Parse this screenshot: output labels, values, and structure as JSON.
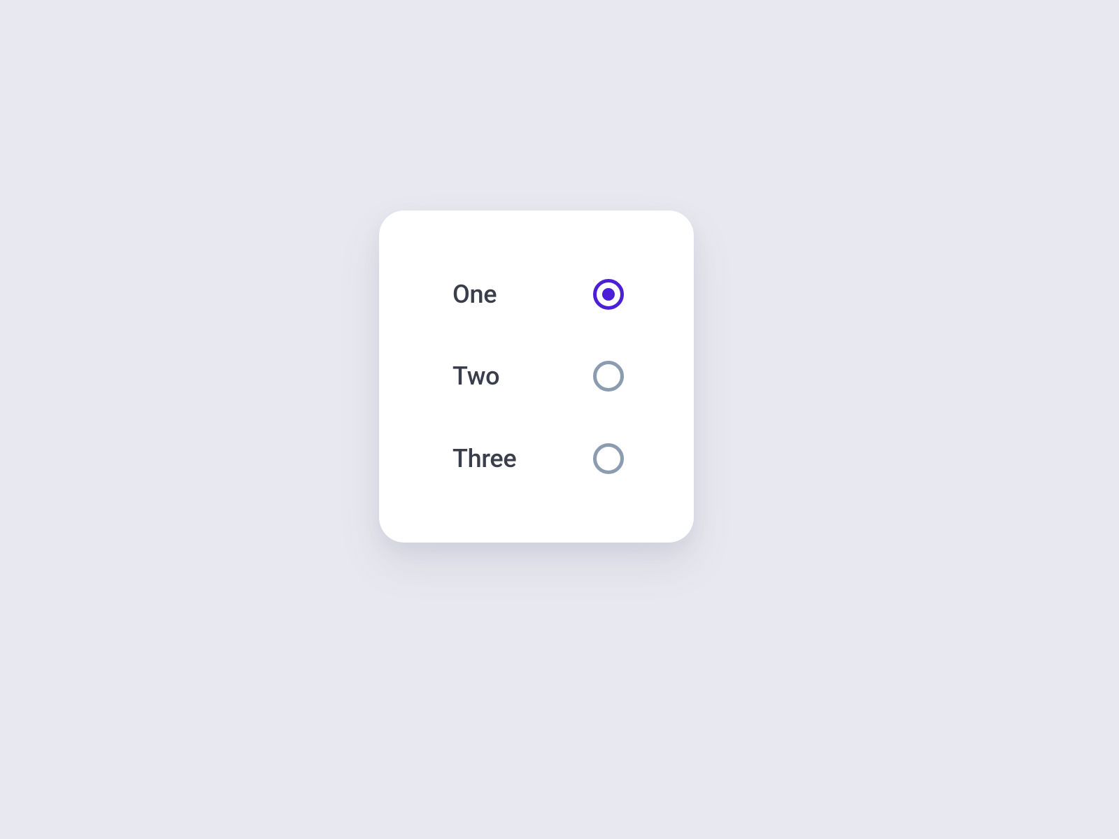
{
  "options": [
    {
      "label": "One",
      "selected": true
    },
    {
      "label": "Two",
      "selected": false
    },
    {
      "label": "Three",
      "selected": false
    }
  ],
  "colors": {
    "background": "#e8e8f0",
    "card": "#ffffff",
    "text": "#3a3d4a",
    "radio_unselected": "#8b9bb0",
    "radio_selected": "#4a1fd6"
  }
}
